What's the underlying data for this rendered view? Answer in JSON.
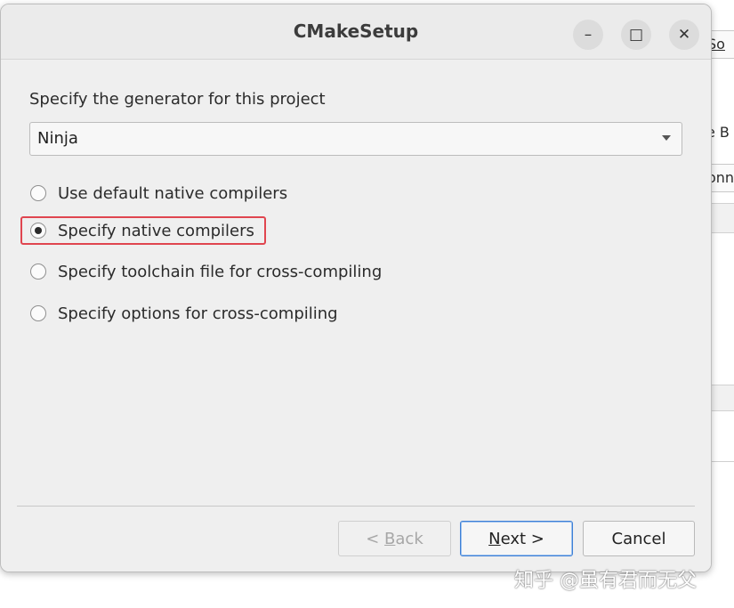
{
  "background_window": {
    "field1": "So",
    "field2": "e B",
    "field3": "onn"
  },
  "dialog": {
    "title": "CMakeSetup",
    "controls": {
      "minimize": "–",
      "maximize": "□",
      "close": "✕"
    },
    "generator_label": "Specify the generator for this project",
    "generator_value": "Ninja",
    "options": [
      {
        "label": "Use default native compilers",
        "checked": false
      },
      {
        "label": "Specify native compilers",
        "checked": true
      },
      {
        "label": "Specify toolchain file for cross-compiling",
        "checked": false
      },
      {
        "label": "Specify options for cross-compiling",
        "checked": false
      }
    ],
    "buttons": {
      "back": {
        "prefix": "< ",
        "mnemonic": "B",
        "rest": "ack"
      },
      "next": {
        "mnemonic": "N",
        "rest": "ext >"
      },
      "cancel": "Cancel"
    }
  },
  "highlight_color": "#e0454f",
  "watermark": "知乎 @虽有君而无父"
}
